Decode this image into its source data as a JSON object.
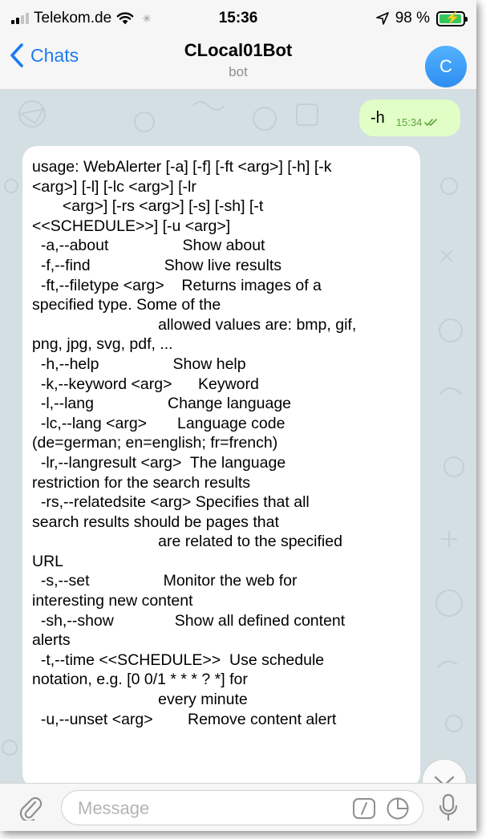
{
  "status_bar": {
    "carrier": "Telekom.de",
    "time": "15:36",
    "battery": "98 %",
    "battery_level": 0.98
  },
  "nav": {
    "back_label": "Chats",
    "title": "CLocal01Bot",
    "subtitle": "bot",
    "avatar_letter": "C"
  },
  "outgoing": {
    "text": "-h",
    "time": "15:34"
  },
  "incoming": {
    "lines": [
      "usage: WebAlerter [-a] [-f] [-ft <arg>] [-h] [-k",
      "<arg>] [-l] [-lc <arg>] [-lr",
      "       <arg>] [-rs <arg>] [-s] [-sh] [-t",
      "<<SCHEDULE>>] [-u <arg>]",
      "  -a,--about                 Show about",
      "  -f,--find                 Show live results",
      "  -ft,--filetype <arg>    Returns images of a",
      "specified type. Some of the",
      "                             allowed values are: bmp, gif,",
      "png, jpg, svg, pdf, ...",
      "  -h,--help                 Show help",
      "  -k,--keyword <arg>      Keyword",
      "  -l,--lang                 Change language",
      "  -lc,--lang <arg>       Language code",
      "(de=german; en=english; fr=french)",
      "  -lr,--langresult <arg>  The language",
      "restriction for the search results",
      "  -rs,--relatedsite <arg> Specifies that all",
      "search results should be pages that",
      "                             are related to the specified",
      "URL",
      "  -s,--set                 Monitor the web for",
      "interesting new content",
      "  -sh,--show              Show all defined content",
      "alerts",
      "  -t,--time <<SCHEDULE>>  Use schedule",
      "notation, e.g. [0 0/1 * * * ? *] for",
      "                             every minute",
      "  -u,--unset <arg>        Remove content alert"
    ]
  },
  "input": {
    "placeholder": "Message"
  },
  "icons": {
    "back": "chevron-left-icon",
    "attach": "paperclip-icon",
    "commands": "slash-command-icon",
    "sticker": "sticker-icon",
    "mic": "microphone-icon",
    "scroll_down": "chevron-down-icon",
    "read": "double-check-icon",
    "location": "location-arrow-icon",
    "wifi": "wifi-icon"
  },
  "colors": {
    "accent": "#1b7cf2",
    "outgoing_bubble": "#e1fec6",
    "chat_background": "#d3dfe2",
    "battery_green": "#35c759"
  }
}
